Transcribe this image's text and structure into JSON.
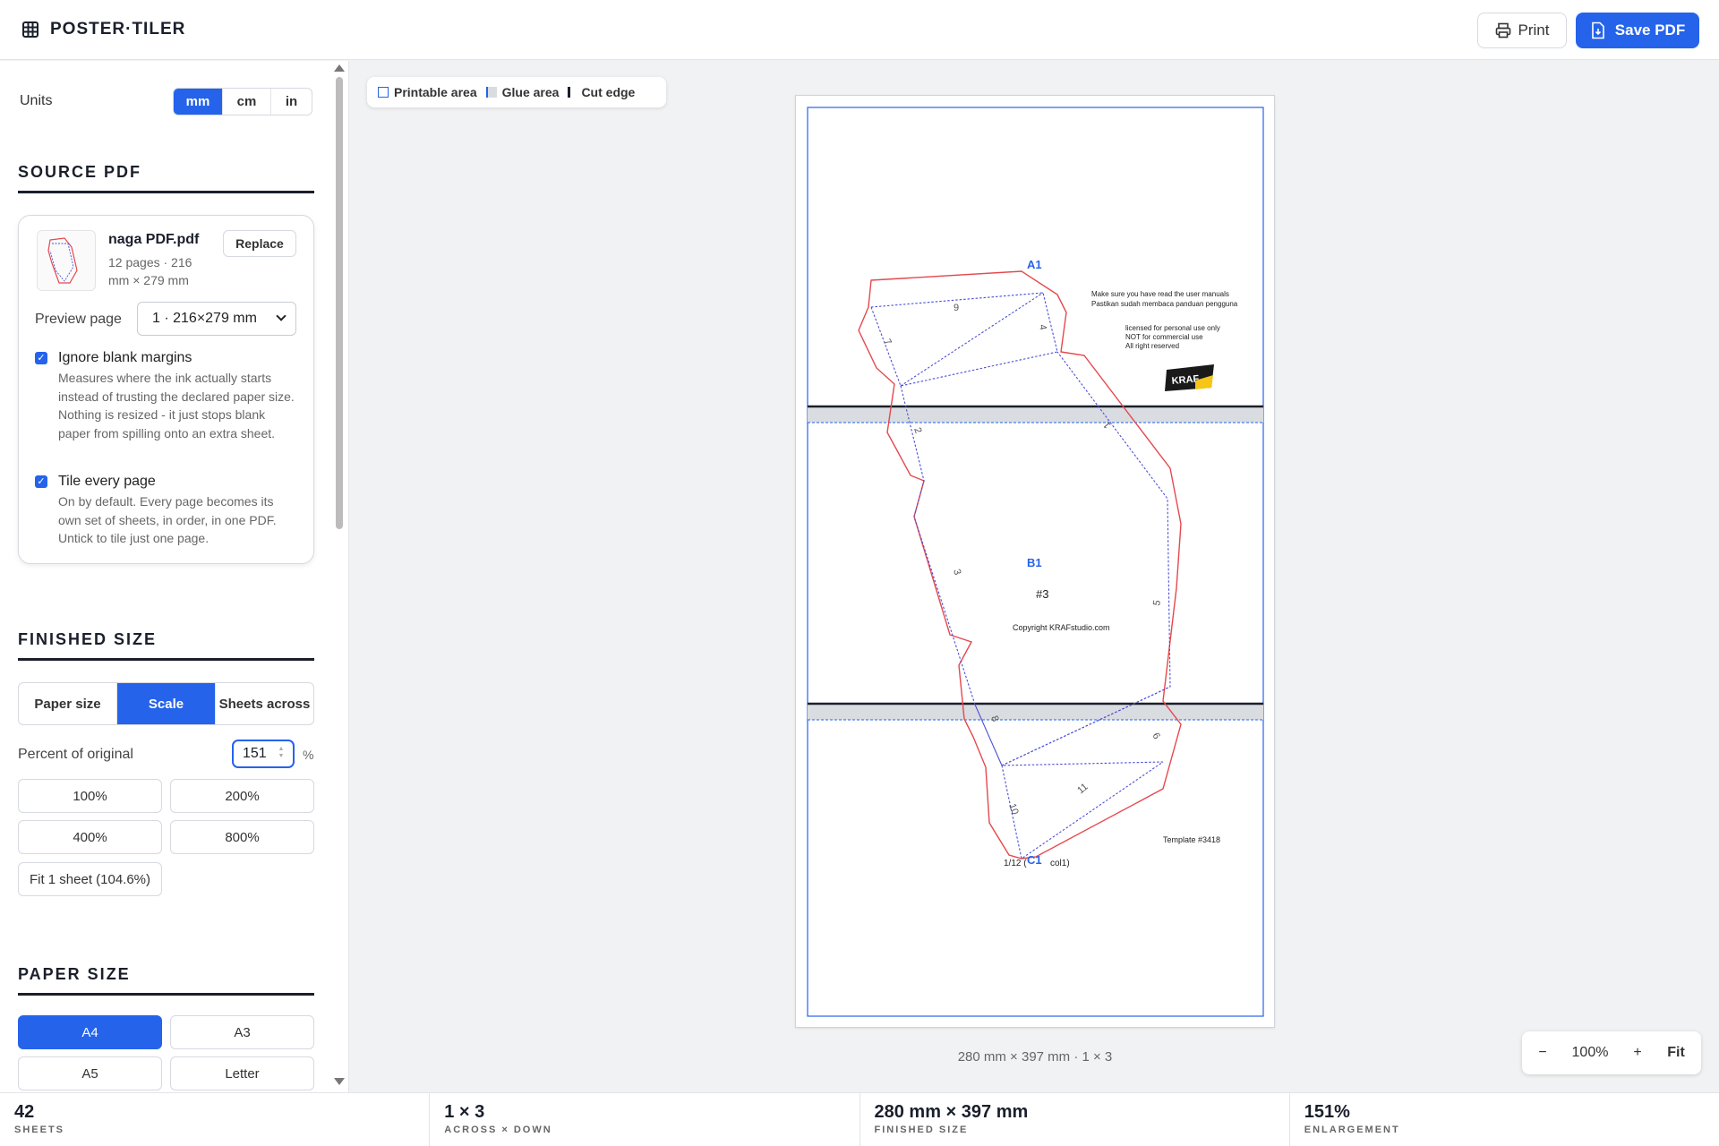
{
  "app": {
    "title": "POSTER·TILER"
  },
  "header": {
    "print_label": "Print",
    "save_label": "Save PDF"
  },
  "units": {
    "label": "Units",
    "options": [
      "mm",
      "cm",
      "in"
    ],
    "selected": "mm"
  },
  "source_pdf": {
    "title": "SOURCE PDF",
    "file_name": "naga PDF.pdf",
    "file_meta": "12 pages · 216 mm × 279 mm",
    "replace_label": "Replace",
    "preview_label": "Preview page",
    "preview_value": "1 · 216×279 mm",
    "ignore_margins": {
      "label": "Ignore blank margins",
      "checked": true,
      "desc": "Measures where the ink actually starts instead of trusting the declared paper size. Nothing is resized - it just stops blank paper from spilling onto an extra sheet."
    },
    "tile_every": {
      "label": "Tile every page",
      "checked": true,
      "desc": "On by default. Every page becomes its own set of sheets, in order, in one PDF. Untick to tile just one page."
    }
  },
  "finished_size": {
    "title": "FINISHED SIZE",
    "tabs": [
      "Paper size",
      "Scale",
      "Sheets across"
    ],
    "selected_tab": "Scale",
    "percent_label": "Percent of original",
    "percent_value": "151",
    "percent_unit": "%",
    "presets": [
      "100%",
      "200%",
      "400%",
      "800%"
    ],
    "fit_label": "Fit 1 sheet (104.6%)"
  },
  "paper_size": {
    "title": "PAPER SIZE",
    "options": [
      "A4",
      "A3",
      "A5",
      "Letter"
    ],
    "selected": "A4"
  },
  "legend": {
    "printable": "Printable area",
    "glue": "Glue area",
    "cut": "Cut edge"
  },
  "preview": {
    "tile_labels": [
      "A1",
      "B1",
      "C1"
    ],
    "notice_lines": [
      "Make sure you have read the user manuals",
      "Pastikan sudah membaca panduan pengguna"
    ],
    "license_lines": [
      "licensed for personal use only",
      "NOT for commercial use",
      "All right reserved"
    ],
    "logo_text": "KRAF",
    "piece_number": "#3",
    "copyright": "Copyright KRAFstudio.com",
    "template": "Template #3418",
    "page_ref": "1/12 (",
    "page_ref_tail": "col1)",
    "fold_numbers": [
      "9",
      "4",
      "7",
      "1",
      "2",
      "3",
      "5",
      "8",
      "6",
      "10",
      "11"
    ],
    "caption": "280 mm × 397 mm · 1 × 3"
  },
  "zoom": {
    "minus": "−",
    "level": "100%",
    "plus": "+",
    "fit": "Fit"
  },
  "stats": [
    {
      "value": "42",
      "label": "SHEETS"
    },
    {
      "value": "1 × 3",
      "label": "ACROSS × DOWN"
    },
    {
      "value": "280 mm × 397 mm",
      "label": "FINISHED SIZE"
    },
    {
      "value": "151%",
      "label": "ENLARGEMENT"
    }
  ],
  "colors": {
    "accent": "#2563eb",
    "cut_line": "#e5484d",
    "fold_line": "#4a4fd6",
    "glue": "#d9dce1"
  }
}
